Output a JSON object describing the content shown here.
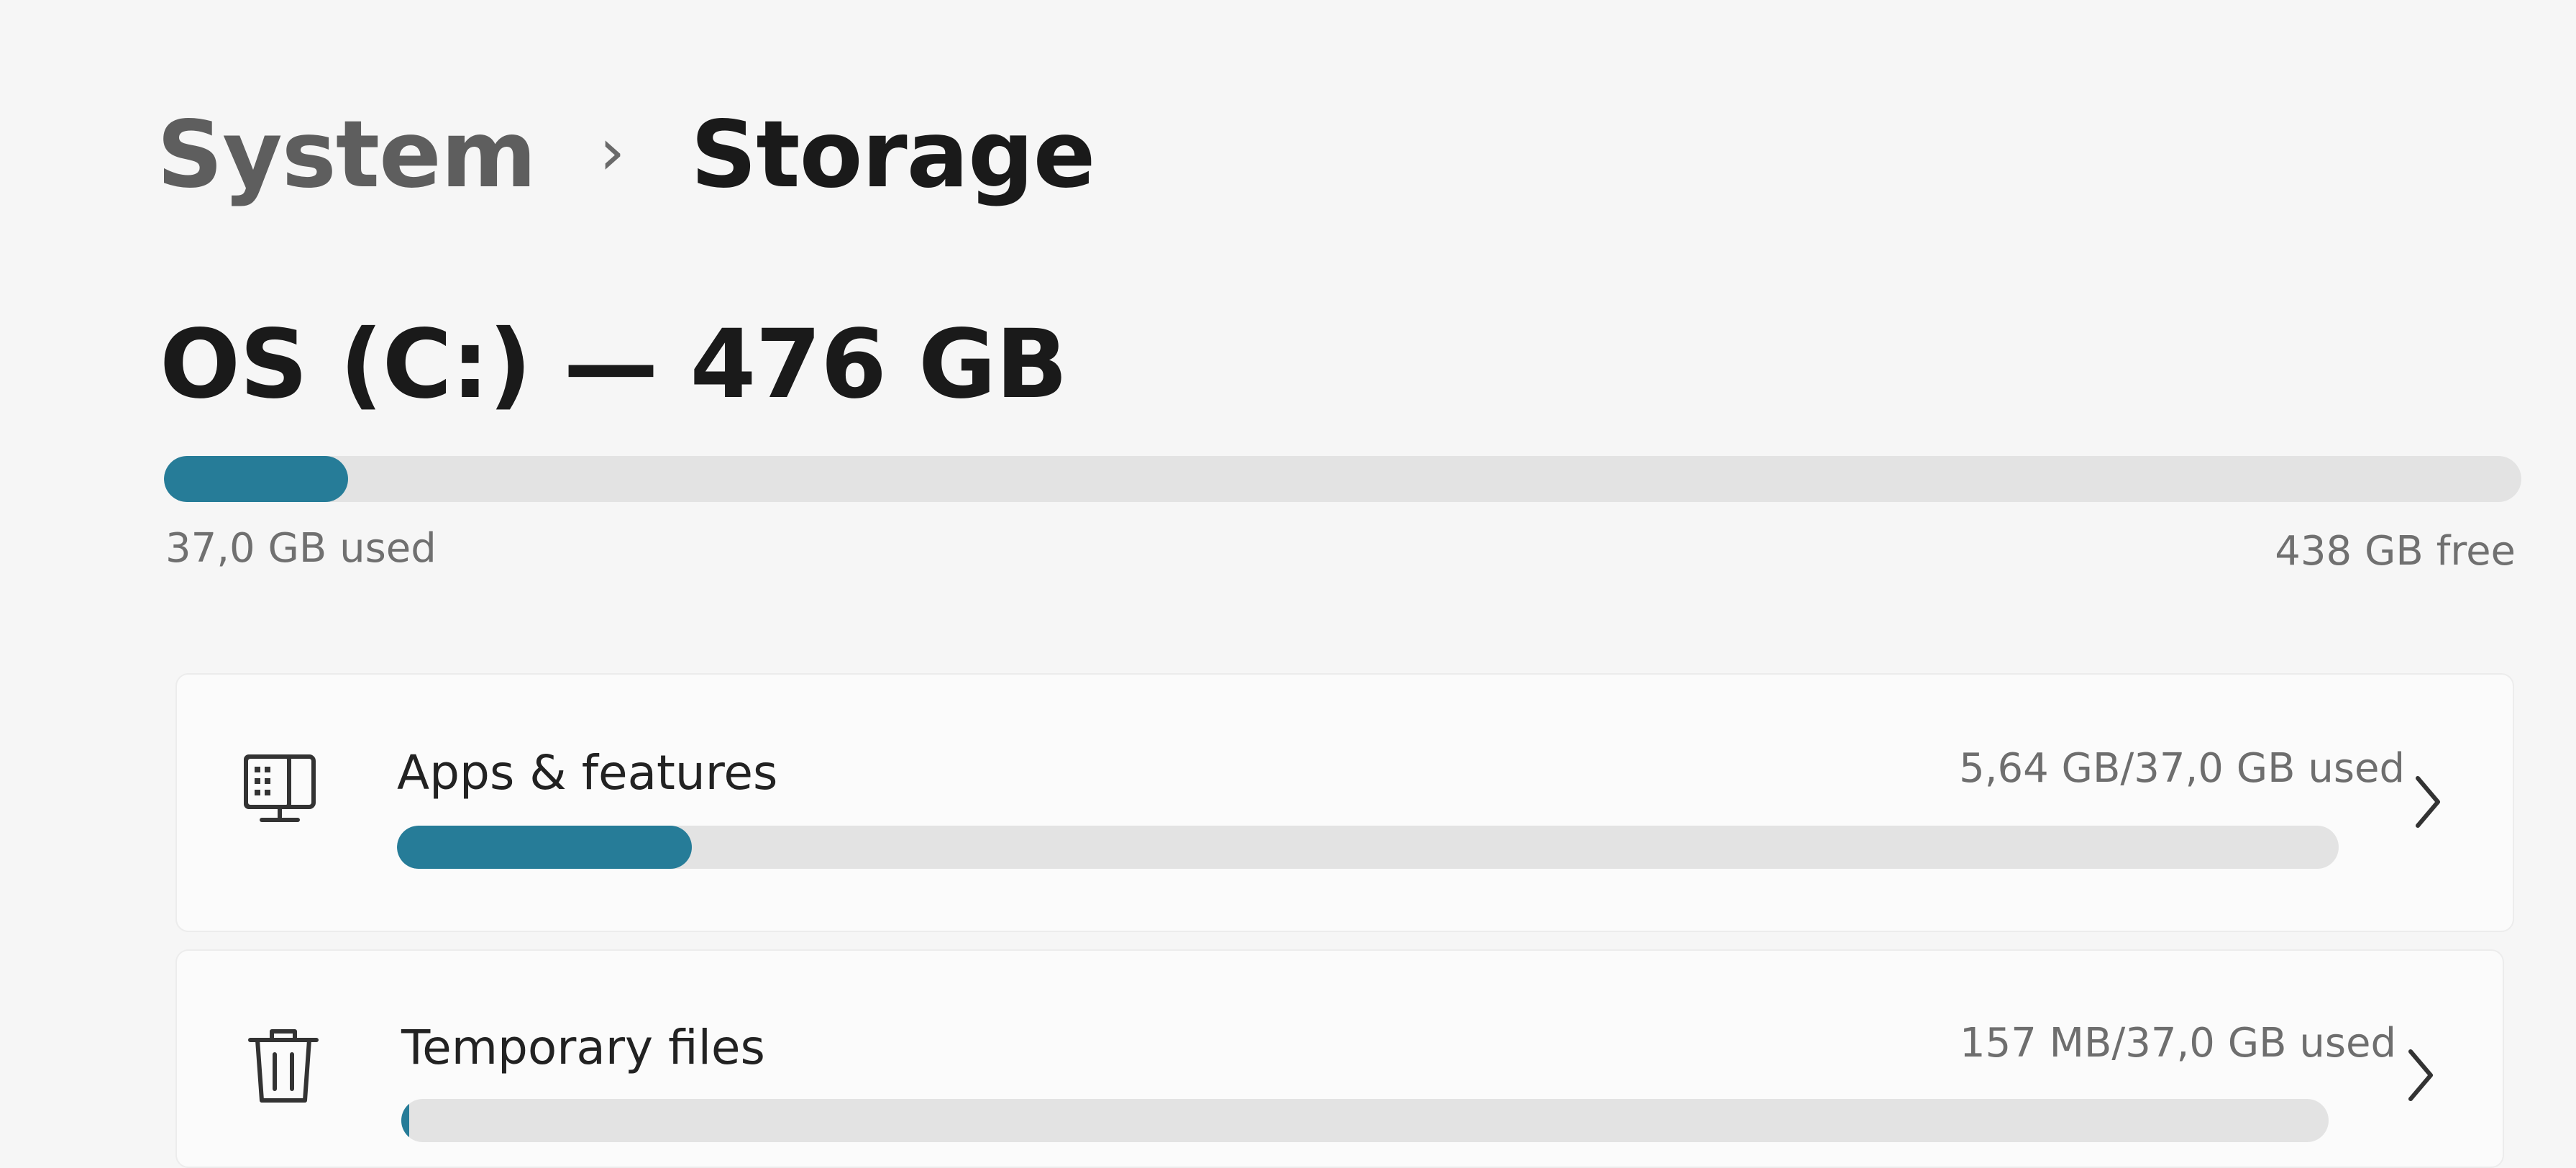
{
  "breadcrumb": {
    "parent": "System",
    "separator": "›",
    "current": "Storage"
  },
  "drive": {
    "title": "OS (C:) — 476 GB",
    "used_label": "37,0 GB used",
    "free_label": "438 GB free",
    "used_fraction": 0.078
  },
  "categories": [
    {
      "icon": "apps-icon",
      "title": "Apps & features",
      "usage": "5,64 GB/37,0 GB used",
      "fraction": 0.152
    },
    {
      "icon": "trash-icon",
      "title": "Temporary files",
      "usage": "157 MB/37,0 GB used",
      "fraction": 0.004
    }
  ],
  "colors": {
    "accent": "#267c98",
    "track": "#e3e3e3",
    "background": "#f6f6f6"
  }
}
